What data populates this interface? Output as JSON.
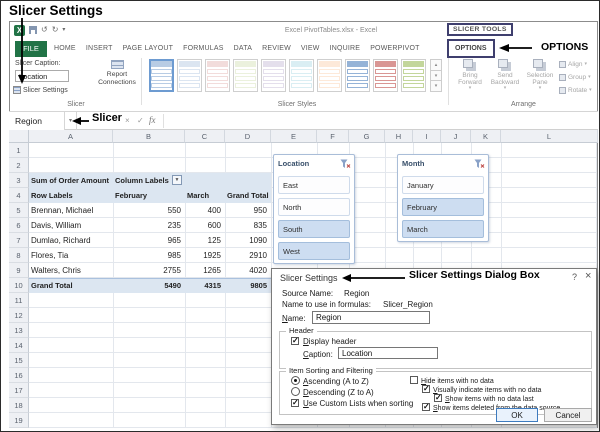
{
  "page_title": "Slicer Settings",
  "annotations": {
    "options": "OPTIONS",
    "slicer": "Slicer",
    "dialog_box": "Slicer Settings Dialog Box"
  },
  "titlebar": {
    "doc_title": "Excel PivotTables.xlsx - Excel",
    "contextual_group": "SLICER TOOLS"
  },
  "ribbon_tabs": {
    "file": "FILE",
    "tabs": [
      "HOME",
      "INSERT",
      "PAGE LAYOUT",
      "FORMULAS",
      "DATA",
      "REVIEW",
      "VIEW",
      "INQUIRE",
      "POWERPIVOT"
    ],
    "active": "OPTIONS"
  },
  "ribbon": {
    "slicer_caption_label": "Slicer Caption:",
    "slicer_caption_value": "Location",
    "slicer_settings_button": "Slicer Settings",
    "report_connections_button": "Report Connections",
    "group_slicer": "Slicer",
    "group_styles": "Slicer Styles",
    "group_arrange": "Arrange",
    "arrange_buttons": [
      "Bring Forward",
      "Send Backward",
      "Selection Pane"
    ],
    "arrange_menus": [
      "Align",
      "Group",
      "Rotate"
    ],
    "style_swatches": [
      "#b8cce4",
      "#dbe5f1",
      "#f2dcdb",
      "#ebf1dd",
      "#e4dfec",
      "#daeef3",
      "#fde9d9",
      "#95b3d7",
      "#d99694",
      "#c3d69b"
    ]
  },
  "formula_bar": {
    "name_box": "Region"
  },
  "sheet": {
    "columns": [
      "A",
      "B",
      "C",
      "D",
      "E",
      "F",
      "G",
      "H",
      "I",
      "J",
      "K",
      "L"
    ],
    "rows": 19,
    "pivot": {
      "a3": "Sum of Order Amount",
      "b3": "Column Labels",
      "header": [
        "Row Labels",
        "February",
        "March",
        "Grand Total"
      ],
      "data": [
        {
          "name": "Brennan, Michael",
          "feb": "550",
          "mar": "400",
          "total": "950"
        },
        {
          "name": "Davis, William",
          "feb": "235",
          "mar": "600",
          "total": "835"
        },
        {
          "name": "Dumlao, Richard",
          "feb": "965",
          "mar": "125",
          "total": "1090"
        },
        {
          "name": "Flores, Tia",
          "feb": "985",
          "mar": "1925",
          "total": "2910"
        },
        {
          "name": "Walters, Chris",
          "feb": "2755",
          "mar": "1265",
          "total": "4020"
        }
      ],
      "grand": {
        "name": "Grand Total",
        "feb": "5490",
        "mar": "4315",
        "total": "9805"
      }
    }
  },
  "slicers": [
    {
      "title": "Location",
      "items": [
        {
          "label": "East",
          "selected": false
        },
        {
          "label": "North",
          "selected": false
        },
        {
          "label": "South",
          "selected": true
        },
        {
          "label": "West",
          "selected": true
        }
      ]
    },
    {
      "title": "Month",
      "items": [
        {
          "label": "January",
          "selected": false
        },
        {
          "label": "February",
          "selected": true
        },
        {
          "label": "March",
          "selected": true
        }
      ]
    }
  ],
  "dialog": {
    "title": "Slicer Settings",
    "help": "?",
    "close": "×",
    "source_name_label": "Source Name:",
    "source_name_value": "Region",
    "formula_name_label": "Name to use in formulas:",
    "formula_name_value": "Slicer_Region",
    "name_label": "Name:",
    "name_value": "Region",
    "header_legend": "Header",
    "display_header_label": "Display header",
    "display_header_checked": true,
    "caption_label": "Caption:",
    "caption_value": "Location",
    "sorting_legend": "Item Sorting and Filtering",
    "ascending_label": "Ascending (A to Z)",
    "ascending_selected": true,
    "descending_label": "Descending (Z to A)",
    "descending_selected": false,
    "custom_lists_label": "Use Custom Lists when sorting",
    "custom_lists_checked": true,
    "hide_items_label": "Hide items with no data",
    "hide_items_checked": false,
    "visually_label": "Visually indicate items with no data",
    "visually_checked": true,
    "show_last_label": "Show items with no data last",
    "show_last_checked": true,
    "show_deleted_label": "Show items deleted from the data source",
    "show_deleted_checked": true,
    "ok": "OK",
    "cancel": "Cancel"
  }
}
